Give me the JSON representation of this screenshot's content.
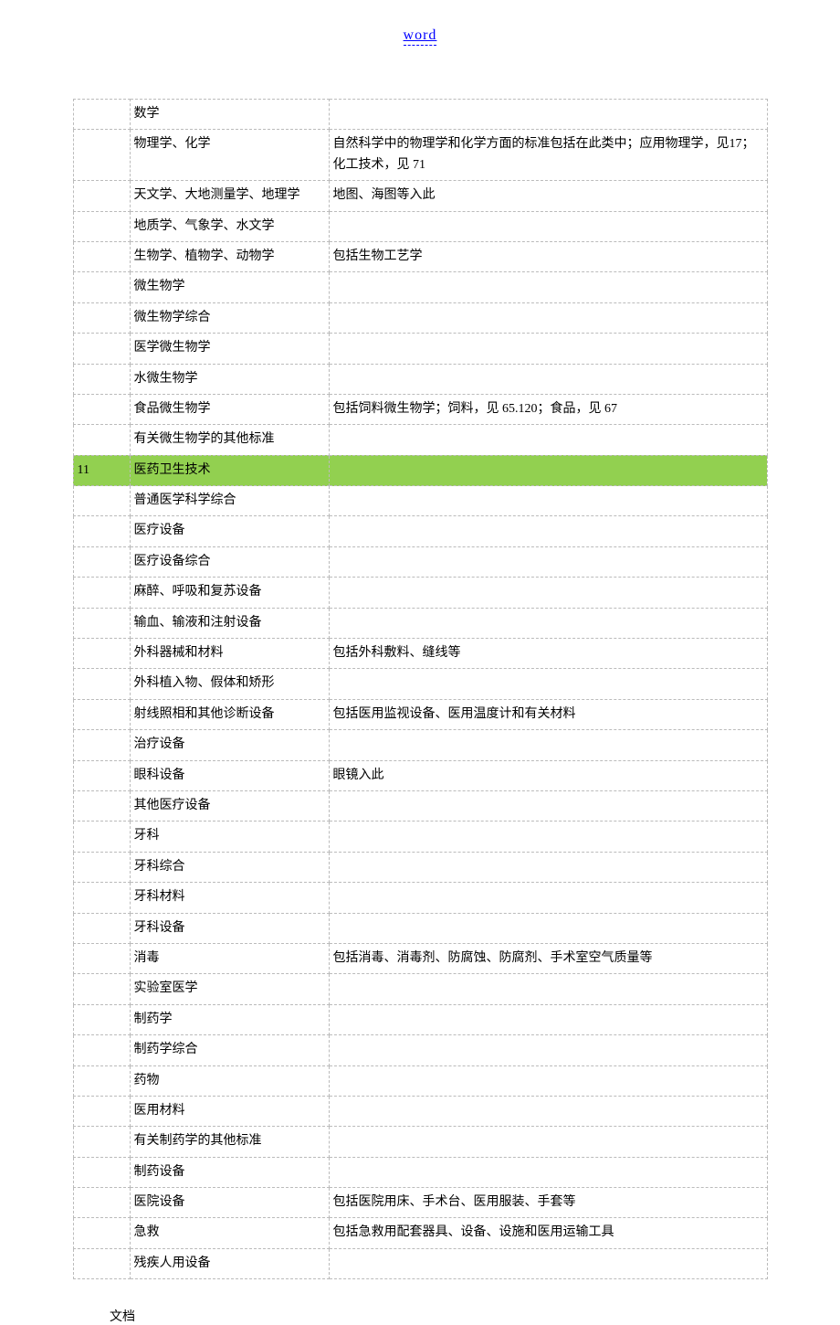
{
  "header": {
    "link_text": "word",
    "link_href": "#"
  },
  "table": {
    "rows": [
      {
        "highlight": false,
        "c1": "",
        "c2": "数学",
        "c3": ""
      },
      {
        "highlight": false,
        "c1": "",
        "c2": "物理学、化学",
        "c3": "自然科学中的物理学和化学方面的标准包括在此类中；应用物理学，见17；化工技术，见 71"
      },
      {
        "highlight": false,
        "c1": "",
        "c2": "天文学、大地测量学、地理学",
        "c3": "地图、海图等入此"
      },
      {
        "highlight": false,
        "c1": "",
        "c2": "地质学、气象学、水文学",
        "c3": ""
      },
      {
        "highlight": false,
        "c1": "",
        "c2": "生物学、植物学、动物学",
        "c3": "包括生物工艺学"
      },
      {
        "highlight": false,
        "c1": "",
        "c2": "微生物学",
        "c3": ""
      },
      {
        "highlight": false,
        "c1": "",
        "c2": "微生物学综合",
        "c3": ""
      },
      {
        "highlight": false,
        "c1": "",
        "c2": "医学微生物学",
        "c3": ""
      },
      {
        "highlight": false,
        "c1": "",
        "c2": "水微生物学",
        "c3": ""
      },
      {
        "highlight": false,
        "c1": "",
        "c2": "食品微生物学",
        "c3": "包括饲料微生物学；饲料，见 65.120；食品，见 67"
      },
      {
        "highlight": false,
        "c1": "",
        "c2": "有关微生物学的其他标准",
        "c3": ""
      },
      {
        "highlight": true,
        "c1": "11",
        "c2": "医药卫生技术",
        "c3": ""
      },
      {
        "highlight": false,
        "c1": "",
        "c2": "普通医学科学综合",
        "c3": ""
      },
      {
        "highlight": false,
        "c1": "",
        "c2": "医疗设备",
        "c3": ""
      },
      {
        "highlight": false,
        "c1": "",
        "c2": "医疗设备综合",
        "c3": ""
      },
      {
        "highlight": false,
        "c1": "",
        "c2": "麻醉、呼吸和复苏设备",
        "c3": ""
      },
      {
        "highlight": false,
        "c1": "",
        "c2": "输血、输液和注射设备",
        "c3": ""
      },
      {
        "highlight": false,
        "c1": "",
        "c2": "外科器械和材料",
        "c3": "包括外科敷料、缝线等"
      },
      {
        "highlight": false,
        "c1": "",
        "c2": "外科植入物、假体和矫形",
        "c3": ""
      },
      {
        "highlight": false,
        "c1": "",
        "c2": "射线照相和其他诊断设备",
        "c3": "包括医用监视设备、医用温度计和有关材料"
      },
      {
        "highlight": false,
        "c1": "",
        "c2": "治疗设备",
        "c3": ""
      },
      {
        "highlight": false,
        "c1": "",
        "c2": "眼科设备",
        "c3": "眼镜入此"
      },
      {
        "highlight": false,
        "c1": "",
        "c2": "其他医疗设备",
        "c3": ""
      },
      {
        "highlight": false,
        "c1": "",
        "c2": "牙科",
        "c3": ""
      },
      {
        "highlight": false,
        "c1": "",
        "c2": "牙科综合",
        "c3": ""
      },
      {
        "highlight": false,
        "c1": "",
        "c2": "牙科材料",
        "c3": ""
      },
      {
        "highlight": false,
        "c1": "",
        "c2": "牙科设备",
        "c3": ""
      },
      {
        "highlight": false,
        "c1": "",
        "c2": "消毒",
        "c3": "包括消毒、消毒剂、防腐蚀、防腐剂、手术室空气质量等"
      },
      {
        "highlight": false,
        "c1": "",
        "c2": "实验室医学",
        "c3": ""
      },
      {
        "highlight": false,
        "c1": "",
        "c2": "制药学",
        "c3": ""
      },
      {
        "highlight": false,
        "c1": "",
        "c2": "制药学综合",
        "c3": ""
      },
      {
        "highlight": false,
        "c1": "",
        "c2": "药物",
        "c3": ""
      },
      {
        "highlight": false,
        "c1": "",
        "c2": "医用材料",
        "c3": ""
      },
      {
        "highlight": false,
        "c1": "",
        "c2": "有关制药学的其他标准",
        "c3": ""
      },
      {
        "highlight": false,
        "c1": "",
        "c2": "制药设备",
        "c3": ""
      },
      {
        "highlight": false,
        "c1": "",
        "c2": "医院设备",
        "c3": "包括医院用床、手术台、医用服装、手套等"
      },
      {
        "highlight": false,
        "c1": "",
        "c2": "急救",
        "c3": "包括急救用配套器具、设备、设施和医用运输工具"
      },
      {
        "highlight": false,
        "c1": "",
        "c2": "残疾人用设备",
        "c3": ""
      }
    ]
  },
  "footer": {
    "text": "文档"
  }
}
